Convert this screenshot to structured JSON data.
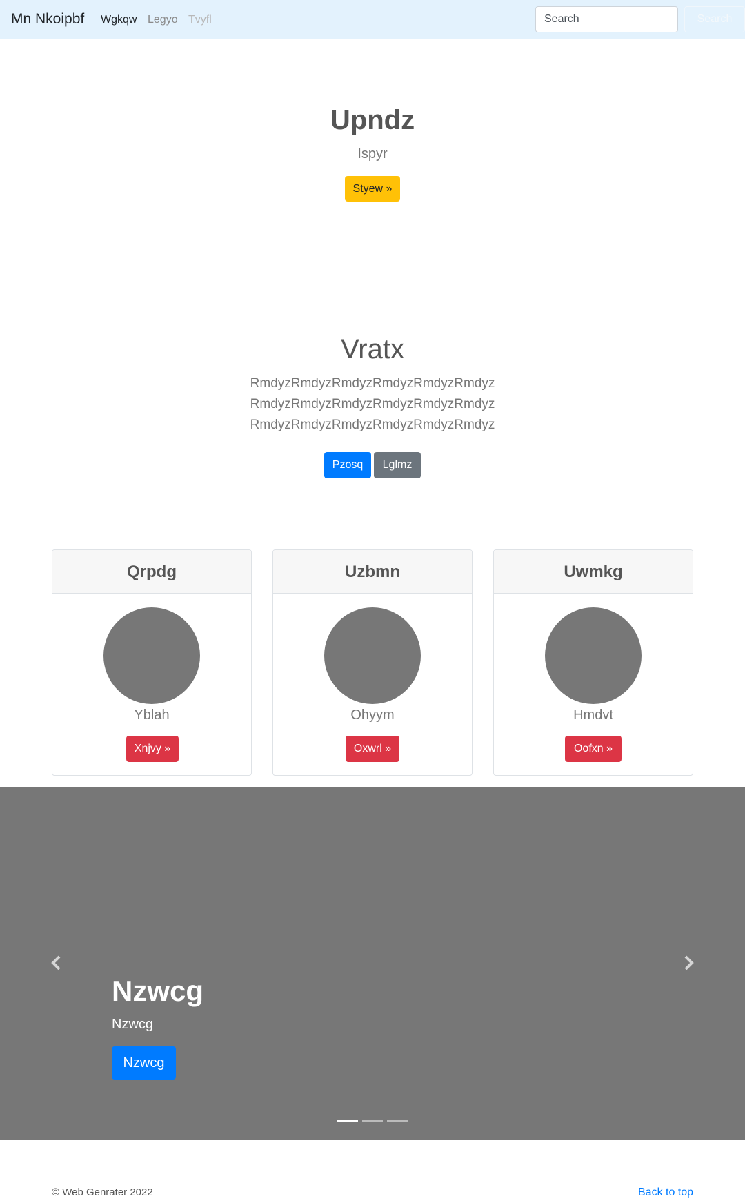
{
  "navbar": {
    "brand": "Mn Nkoipbf",
    "links": [
      "Wgkqw",
      "Legyo",
      "Tvyfl"
    ],
    "search_placeholder": "Search",
    "search_button": "Search"
  },
  "hero": {
    "title": "Upndz",
    "subtitle": "Ispyr",
    "button": "Styew »"
  },
  "feature": {
    "title": "Vratx",
    "lines": [
      "RmdyzRmdyzRmdyzRmdyzRmdyzRmdyz",
      "RmdyzRmdyzRmdyzRmdyzRmdyzRmdyz",
      "RmdyzRmdyzRmdyzRmdyzRmdyzRmdyz"
    ],
    "primary_button": "Pzosq",
    "secondary_button": "Lglmz"
  },
  "cards": [
    {
      "header": "Qrpdg",
      "name": "Yblah",
      "button": "Xnjvy »"
    },
    {
      "header": "Uzbmn",
      "name": "Ohyym",
      "button": "Oxwrl »"
    },
    {
      "header": "Uwmkg",
      "name": "Hmdvt",
      "button": "Oofxn »"
    }
  ],
  "carousel": {
    "title": "Nzwcg",
    "subtitle": "Nzwcg",
    "button": "Nzwcg",
    "indicators": 3,
    "active_index": 0,
    "prev_icon": "chevron-left-icon",
    "next_icon": "chevron-right-icon"
  },
  "footer": {
    "copyright": "© Web Genrater 2022",
    "back_to_top": "Back to top"
  },
  "colors": {
    "navbar_bg": "#e3f2fd",
    "warning": "#ffc107",
    "primary": "#007bff",
    "secondary": "#6c757d",
    "danger": "#dc3545",
    "placeholder_gray": "#777777"
  }
}
